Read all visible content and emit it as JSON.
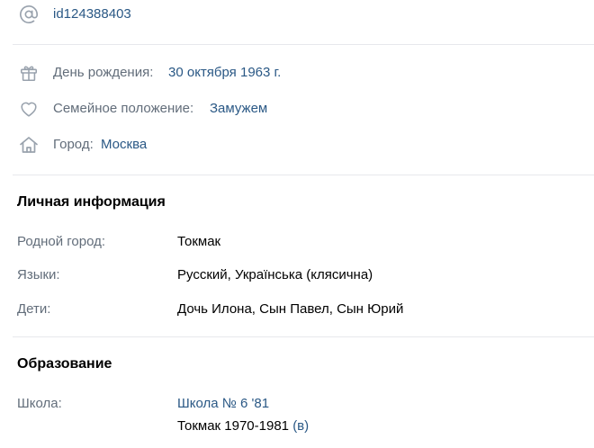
{
  "contacts": {
    "user_id": "id124388403",
    "birthday_label": "День рождения:",
    "birthday_value": "30 октября 1963 г.",
    "relationship_label": "Семейное положение:",
    "relationship_value": "Замужем",
    "city_label": "Город:",
    "city_value": "Москва"
  },
  "personal": {
    "title": "Личная информация",
    "rows": [
      {
        "label": "Родной город:",
        "value": "Токмак"
      },
      {
        "label": "Языки:",
        "value": "Русский, Українська (клясична)"
      },
      {
        "label": "Дети:",
        "value": "Дочь Илона, Сын Павел, Сын Юрий"
      }
    ]
  },
  "education": {
    "title": "Образование",
    "school_label": "Школа:",
    "school_name": "Школа № 6 '81",
    "school_details": "Токмак 1970-1981",
    "school_class": "(в)"
  },
  "icons": [
    "at-icon",
    "gift-icon",
    "heart-icon",
    "home-icon"
  ],
  "colors": {
    "link": "#2a5885",
    "muted": "#626d7a",
    "icon": "#99a2ad",
    "divider": "#e7e8ec"
  }
}
